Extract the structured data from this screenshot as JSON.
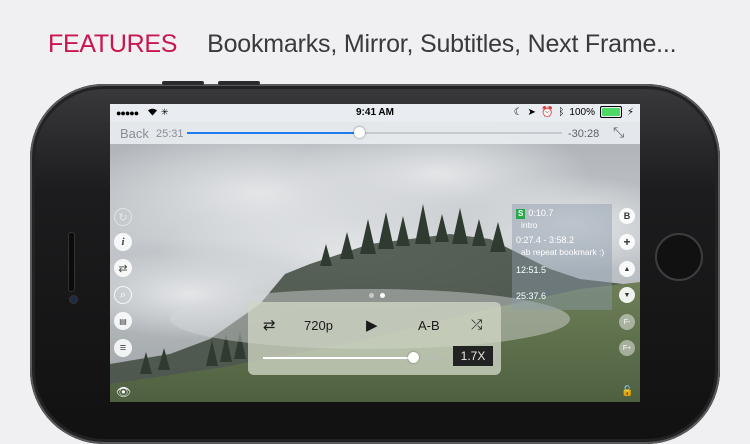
{
  "headline": {
    "features": "FEATURES",
    "subtitle": "Bookmarks, Mirror, Subtitles, Next Frame..."
  },
  "status_bar": {
    "signal": "●●●●●",
    "time": "9:41 AM",
    "battery": "100%"
  },
  "seek_bar": {
    "back_label": "Back",
    "elapsed": "25:31",
    "remaining": "-30:28",
    "progress": 0.46
  },
  "bookmarks": {
    "badge": "S",
    "items": [
      {
        "time": "0:10.7",
        "note": "intro"
      },
      {
        "time": "0:27.4 - 3:58.2",
        "note": "ab repeat bookmark :)"
      },
      {
        "time": "12:51.5",
        "note": ""
      },
      {
        "time": "25:37.6",
        "note": ""
      }
    ]
  },
  "right_column": {
    "bookmark_label": "B",
    "add_label": "+",
    "prev_frame_label": "F-",
    "next_frame_label": "F+"
  },
  "controls": {
    "quality": "720p",
    "ab_label": "A-B",
    "speed": "1.7X",
    "speed_level": 0.85
  },
  "colors": {
    "accent": "#c8174f",
    "seek_fill": "#1c7cf0",
    "bookmark_badge": "#2aa84b"
  }
}
